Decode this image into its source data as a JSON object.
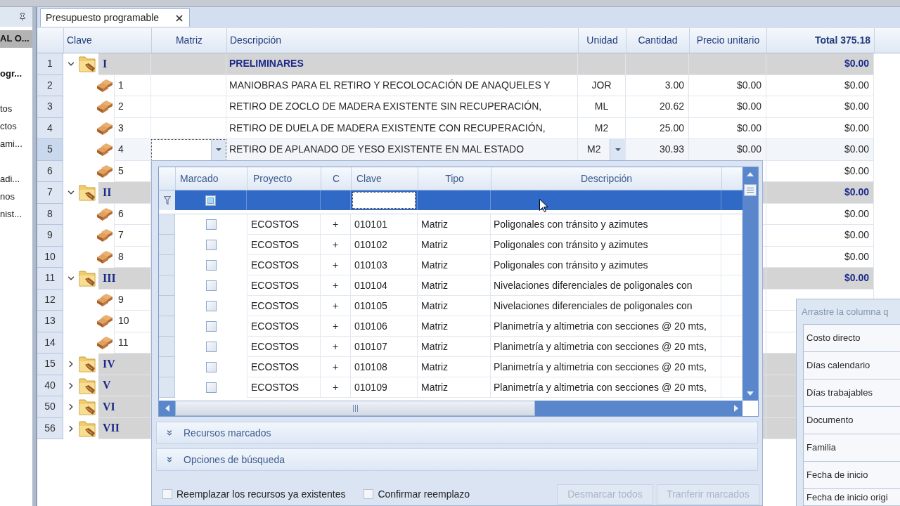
{
  "sidebar": {
    "sections": [
      {
        "title": "AL O...",
        "selected": true
      },
      {
        "title": "ogr...",
        "selected": false,
        "groups": [
          [
            "tos",
            "ctos",
            "ami..."
          ],
          [
            "adi...",
            "nos",
            "nist..."
          ]
        ]
      }
    ]
  },
  "tabs": [
    {
      "label": "Presupuesto programable",
      "selected": true
    }
  ],
  "grid": {
    "columns": [
      {
        "label": "Clave"
      },
      {
        "label": "Matriz"
      },
      {
        "label": "Descripción"
      },
      {
        "label": "Unidad"
      },
      {
        "label": "Cantidad"
      },
      {
        "label": "Precio unitario"
      },
      {
        "label": "Total 375.18"
      }
    ],
    "rows": [
      {
        "number": "1",
        "kind": "group",
        "clave": "I",
        "expanded": true,
        "descripcion": "PRELIMINARES",
        "total": "$0.00",
        "editing": false
      },
      {
        "number": "2",
        "kind": "item",
        "clave": "1",
        "descripcion": "MANIOBRAS PARA EL RETIRO Y RECOLOCACIÓN DE ANAQUELES Y",
        "unidad": "JOR",
        "cantidad": "3.00",
        "precio_unitario": "$0.00",
        "total": "$0.00",
        "editing": false
      },
      {
        "number": "3",
        "kind": "item",
        "clave": "2",
        "descripcion": "RETIRO DE ZOCLO DE MADERA EXISTENTE SIN RECUPERACIÓN,",
        "unidad": "ML",
        "cantidad": "20.62",
        "precio_unitario": "$0.00",
        "total": "$0.00",
        "editing": false
      },
      {
        "number": "4",
        "kind": "item",
        "clave": "3",
        "descripcion": "RETIRO DE DUELA DE MADERA EXISTENTE CON RECUPERACIÓN,",
        "unidad": "M2",
        "cantidad": "25.00",
        "precio_unitario": "$0.00",
        "total": "$0.00",
        "editing": false
      },
      {
        "number": "5",
        "kind": "item",
        "clave": "4",
        "descripcion": "RETIRO DE APLANADO DE YESO EXISTENTE EN MAL ESTADO",
        "unidad": "M2",
        "cantidad": "30.93",
        "precio_unitario": "$0.00",
        "total": "$0.00",
        "editing": true
      },
      {
        "number": "6",
        "kind": "item",
        "clave": "5",
        "total": "$0.00",
        "editing": false
      },
      {
        "number": "7",
        "kind": "group",
        "clave": "II",
        "expanded": true,
        "total": "$0.00",
        "editing": false
      },
      {
        "number": "8",
        "kind": "item",
        "clave": "6",
        "total": "$0.00",
        "editing": false
      },
      {
        "number": "9",
        "kind": "item",
        "clave": "7",
        "total": "$0.00",
        "editing": false
      },
      {
        "number": "10",
        "kind": "item",
        "clave": "8",
        "total": "$0.00",
        "editing": false
      },
      {
        "number": "11",
        "kind": "group",
        "clave": "III",
        "expanded": true,
        "total": "$0.00",
        "editing": false
      },
      {
        "number": "12",
        "kind": "item",
        "clave": "9",
        "editing": false
      },
      {
        "number": "13",
        "kind": "item",
        "clave": "10",
        "editing": false
      },
      {
        "number": "14",
        "kind": "item",
        "clave": "11",
        "editing": false
      },
      {
        "number": "15",
        "kind": "group",
        "clave": "IV",
        "expanded": false,
        "editing": false
      },
      {
        "number": "40",
        "kind": "group",
        "clave": "V",
        "expanded": false,
        "editing": false
      },
      {
        "number": "50",
        "kind": "group",
        "clave": "VI",
        "expanded": false,
        "editing": false
      },
      {
        "number": "56",
        "kind": "group",
        "clave": "VII",
        "expanded": false,
        "editing": false
      }
    ]
  },
  "lookup": {
    "columns": [
      {
        "label": "Marcado"
      },
      {
        "label": "Proyecto"
      },
      {
        "label": "C"
      },
      {
        "label": "Clave"
      },
      {
        "label": "Tipo"
      },
      {
        "label": "Descripción"
      }
    ],
    "filter": {
      "indeterminate": true
    },
    "rows": [
      {
        "marked": false,
        "proyecto": "ECOSTOS",
        "c": "+",
        "clave": "010101",
        "tipo": "Matriz",
        "descripcion": "Poligonales con tránsito y azimutes"
      },
      {
        "marked": false,
        "proyecto": "ECOSTOS",
        "c": "+",
        "clave": "010102",
        "tipo": "Matriz",
        "descripcion": "Poligonales con tránsito y azimutes"
      },
      {
        "marked": false,
        "proyecto": "ECOSTOS",
        "c": "+",
        "clave": "010103",
        "tipo": "Matriz",
        "descripcion": "Poligonales con tránsito y azimutes"
      },
      {
        "marked": false,
        "proyecto": "ECOSTOS",
        "c": "+",
        "clave": "010104",
        "tipo": "Matriz",
        "descripcion": "Nivelaciones diferenciales de poligonales con"
      },
      {
        "marked": false,
        "proyecto": "ECOSTOS",
        "c": "+",
        "clave": "010105",
        "tipo": "Matriz",
        "descripcion": "Nivelaciones diferenciales de poligonales con"
      },
      {
        "marked": false,
        "proyecto": "ECOSTOS",
        "c": "+",
        "clave": "010106",
        "tipo": "Matriz",
        "descripcion": "Planimetría y altimetria con secciones @ 20 mts,"
      },
      {
        "marked": false,
        "proyecto": "ECOSTOS",
        "c": "+",
        "clave": "010107",
        "tipo": "Matriz",
        "descripcion": "Planimetría y altimetria con secciones @ 20 mts,"
      },
      {
        "marked": false,
        "proyecto": "ECOSTOS",
        "c": "+",
        "clave": "010108",
        "tipo": "Matriz",
        "descripcion": "Planimetría y altimetria con secciones @ 20 mts,"
      },
      {
        "marked": false,
        "proyecto": "ECOSTOS",
        "c": "+",
        "clave": "010109",
        "tipo": "Matriz",
        "descripcion": "Planimetría y altimetria con secciones @ 20 mts,"
      }
    ],
    "sections": [
      {
        "label": "Recursos marcados",
        "expanded": false
      },
      {
        "label": "Opciones de búsqueda",
        "expanded": false
      }
    ],
    "options": [
      {
        "label": "Reemplazar los recursos ya existentes",
        "checked": false
      },
      {
        "label": "Confirmar reemplazo",
        "checked": false
      }
    ],
    "buttons": [
      {
        "label": "Desmarcar todos",
        "disabled": true
      },
      {
        "label": "Tranferir marcados",
        "disabled": true
      }
    ]
  },
  "column_chooser": {
    "hint": "Arrastre la columna q",
    "items": [
      "Costo directo",
      "Días calendario",
      "Días trabajables",
      "Documento",
      "Familia",
      "Fecha de inicio",
      "Fecha de inicio origi"
    ]
  }
}
